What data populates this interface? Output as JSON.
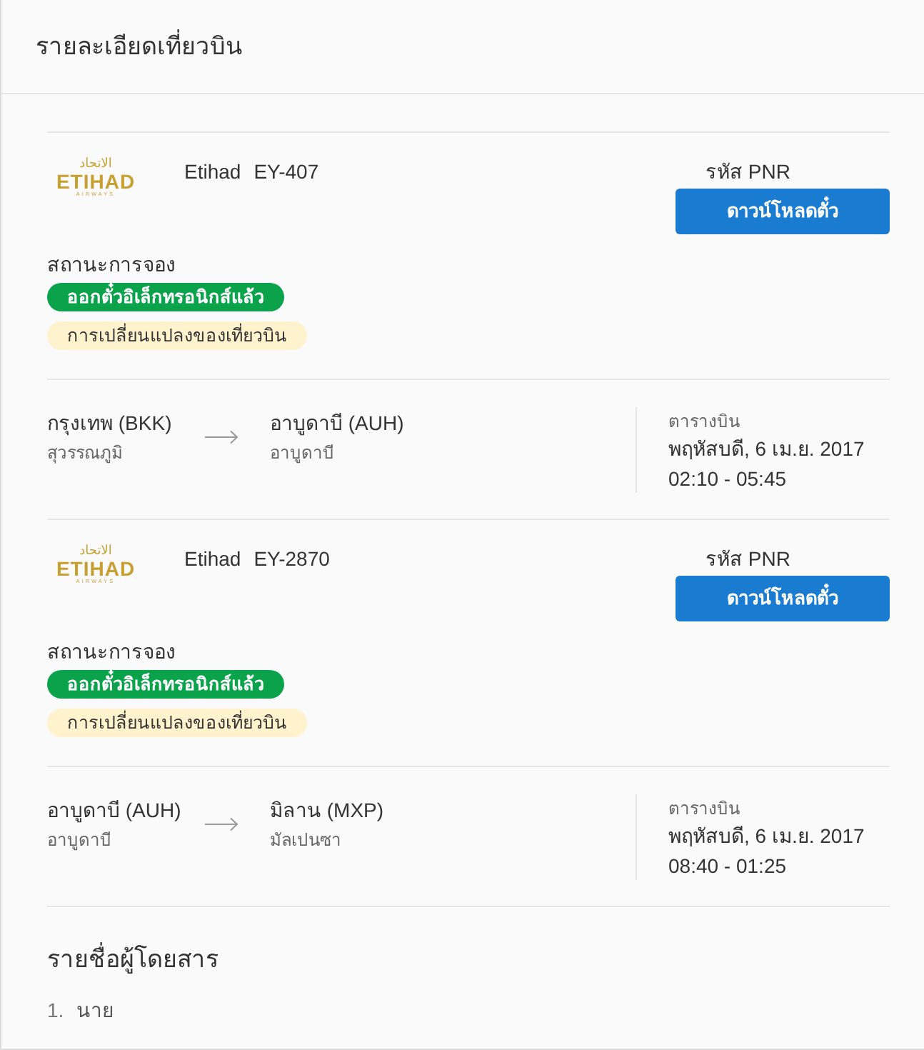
{
  "page": {
    "title": "รายละเอียดเที่ยวบิน"
  },
  "flights": [
    {
      "logo": {
        "arabic": "الاتحاد",
        "wordmark": "ETIHAD",
        "tagline": "AIRWAYS"
      },
      "airline": "Etihad",
      "flight_number": "EY-407",
      "pnr_label": "รหัส PNR",
      "download_button": "ดาวน์โหลดตั๋ว",
      "status_label": "สถานะการจอง",
      "statuses": [
        {
          "text": "ออกตั๋วอิเล็กทรอนิกส์แล้ว",
          "kind": "success"
        },
        {
          "text": "การเปลี่ยนแปลงของเที่ยวบิน",
          "kind": "warning"
        }
      ],
      "origin": {
        "city": "กรุงเทพ (BKK)",
        "airport": "สุวรรณภูมิ"
      },
      "destination": {
        "city": "อาบูดาบี (AUH)",
        "airport": "อาบูดาบี"
      },
      "schedule_label": "ตารางบิน",
      "date": "พฤหัสบดี, 6 เม.ย. 2017",
      "time": "02:10 - 05:45"
    },
    {
      "logo": {
        "arabic": "الاتحاد",
        "wordmark": "ETIHAD",
        "tagline": "AIRWAYS"
      },
      "airline": "Etihad",
      "flight_number": "EY-2870",
      "pnr_label": "รหัส PNR",
      "download_button": "ดาวน์โหลดตั๋ว",
      "status_label": "สถานะการจอง",
      "statuses": [
        {
          "text": "ออกตั๋วอิเล็กทรอนิกส์แล้ว",
          "kind": "success"
        },
        {
          "text": "การเปลี่ยนแปลงของเที่ยวบิน",
          "kind": "warning"
        }
      ],
      "origin": {
        "city": "อาบูดาบี (AUH)",
        "airport": "อาบูดาบี"
      },
      "destination": {
        "city": "มิลาน (MXP)",
        "airport": "มัลเปนซา"
      },
      "schedule_label": "ตารางบิน",
      "date": "พฤหัสบดี, 6 เม.ย. 2017",
      "time": "08:40 - 01:25"
    }
  ],
  "passengers": {
    "title": "รายชื่อผู้โดยสาร",
    "items": [
      {
        "number": "1.",
        "name": "นาย"
      }
    ]
  }
}
